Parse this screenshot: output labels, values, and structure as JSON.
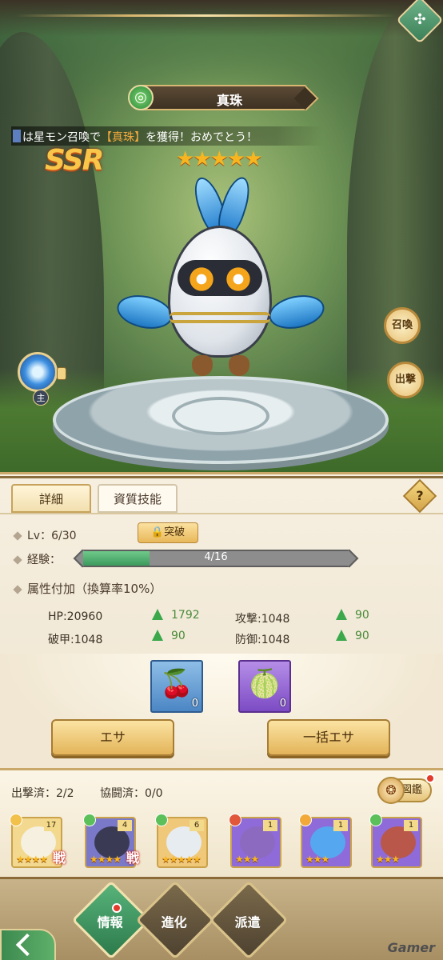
{
  "monster": {
    "name": "真珠",
    "rarity": "SSR",
    "stars": "★★★★★",
    "element_icon": "wind-swirl-icon"
  },
  "ticker": {
    "prefix": "は星モン召喚で",
    "highlight": "【真珠】",
    "suffix": "を獲得！おめでとう！"
  },
  "side_buttons": {
    "summon": "召喚",
    "sortie": "出撃",
    "skill_badge": "主"
  },
  "tabs": [
    {
      "label": "詳細",
      "active": true
    },
    {
      "label": "資質技能",
      "active": false
    }
  ],
  "help_label": "?",
  "details": {
    "level": "Lv：6/30",
    "breakthrough": "突破",
    "exp_label": "経験：",
    "exp_text": "4/16",
    "exp_progress": 0.25,
    "attr_title": "属性付加（換算率10%）"
  },
  "stats": [
    {
      "label": "HP:20960",
      "bonus": "1792"
    },
    {
      "label": "攻撃:1048",
      "bonus": "90"
    },
    {
      "label": "破甲:1048",
      "bonus": "90"
    },
    {
      "label": "防御:1048",
      "bonus": "90"
    }
  ],
  "items": [
    {
      "name": "cherry-item",
      "icon": "🍒",
      "count": "0"
    },
    {
      "name": "fruit-item",
      "icon": "🍈",
      "count": "0"
    }
  ],
  "actions": {
    "feed": "エサ",
    "bulk_feed": "一括エサ"
  },
  "roster": {
    "sortie_count": "出撃済：2/2",
    "coop_count": "協闘済：0/0",
    "dex": "図鑑",
    "cards": [
      {
        "level": "17",
        "stars": "★★★★",
        "war": "戦",
        "element": "#f2c14b",
        "bg": "#f3d98f",
        "face": "#f5f0e0"
      },
      {
        "level": "4",
        "stars": "★★★★",
        "war": "戦",
        "element": "#5bbf5a",
        "bg": "#7a78c8",
        "face": "#3a3a55"
      },
      {
        "level": "6",
        "stars": "★★★★★",
        "war": "",
        "element": "#5bbf5a",
        "bg": "#f0c87a",
        "face": "#e7ecf1"
      },
      {
        "level": "1",
        "stars": "★★★",
        "war": "",
        "element": "#e0573a",
        "bg": "#8e6bd8",
        "face": "#8c6ac0"
      },
      {
        "level": "1",
        "stars": "★★★",
        "war": "",
        "element": "#f2a93a",
        "bg": "#8e6bd8",
        "face": "#55a8f0"
      },
      {
        "level": "1",
        "stars": "★★★",
        "war": "",
        "element": "#5bbf5a",
        "bg": "#8e6bd8",
        "face": "#b9574a"
      }
    ]
  },
  "nav": {
    "info": "情報",
    "evolve": "進化",
    "dispatch": "派遣"
  },
  "watermark": "Gamer"
}
